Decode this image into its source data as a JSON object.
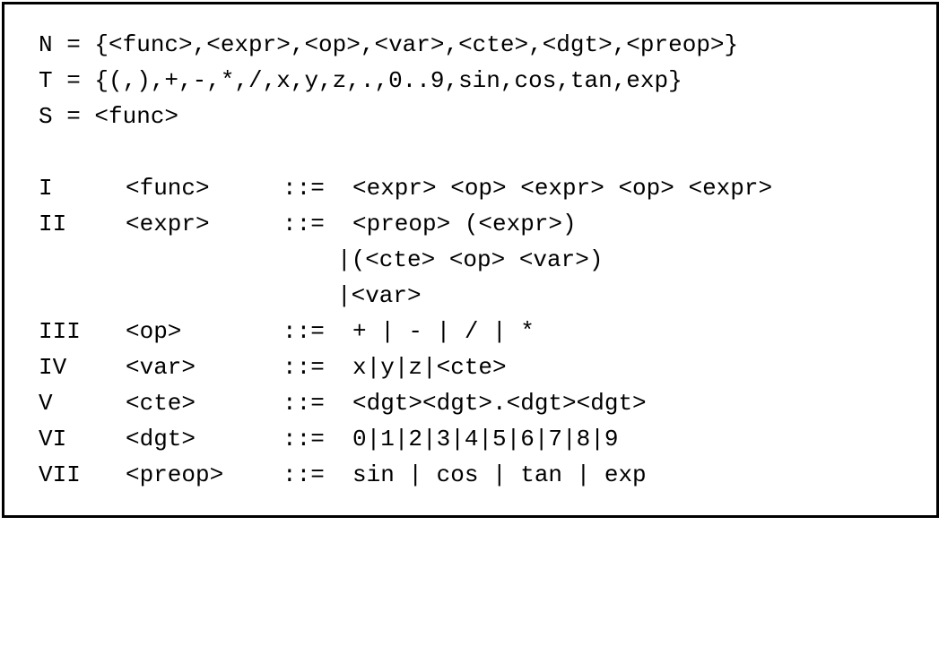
{
  "sets": {
    "N": "N = {<func>,<expr>,<op>,<var>,<cte>,<dgt>,<preop>}",
    "T": "T = {(,),+,-,*,/,x,y,z,.,0..9,sin,cos,tan,exp}",
    "S": "S = <func>"
  },
  "rules": [
    {
      "num": "I",
      "nt": "<func>",
      "def": "::=",
      "rhs": "<expr> <op> <expr> <op> <expr>"
    },
    {
      "num": "II",
      "nt": "<expr>",
      "def": "::=",
      "rhs": "<preop> (<expr>)"
    },
    {
      "num": "",
      "nt": "",
      "def": "",
      "rhs": "|(<cte> <op> <var>)"
    },
    {
      "num": "",
      "nt": "",
      "def": "",
      "rhs": "|<var>"
    },
    {
      "num": "III",
      "nt": "<op>",
      "def": "::=",
      "rhs": "+ | - | / | *"
    },
    {
      "num": "IV",
      "nt": "<var>",
      "def": "::=",
      "rhs": "x|y|z|<cte>"
    },
    {
      "num": "V",
      "nt": "<cte>",
      "def": "::=",
      "rhs": "<dgt><dgt>.<dgt><dgt>"
    },
    {
      "num": "VI",
      "nt": "<dgt>",
      "def": "::=",
      "rhs": "0|1|2|3|4|5|6|7|8|9"
    },
    {
      "num": "VII",
      "nt": "<preop>",
      "def": "::=",
      "rhs": "sin | cos | tan | exp"
    }
  ]
}
